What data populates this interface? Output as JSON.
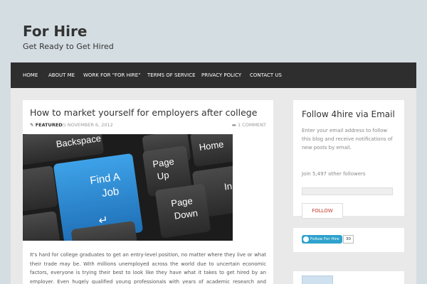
{
  "site": {
    "title": "For Hire",
    "description": "Get Ready to Get Hired"
  },
  "nav": {
    "items": [
      "HOME",
      "ABOUT ME",
      "WORK FOR \"FOR HIRE\"",
      "TERMS OF SERVICE",
      "PRIVACY POLICY",
      "CONTACT US"
    ]
  },
  "post": {
    "title": "How to market yourself for employers after college",
    "category": "FEATURED",
    "date": "NOVEMBER 6, 2012",
    "comments": "1 COMMENT",
    "image_keys": {
      "backspace": "Backspace",
      "home": "Home",
      "find": "Find A",
      "job": "Job",
      "page_up_1": "Page",
      "page_up_2": "Up",
      "page_down_1": "Page",
      "page_down_2": "Down",
      "partial": "In"
    },
    "excerpt": "It's hard for college graduates to get an entry-level position, no matter where they live or what their trade may be. With millions unemployed across the world due to uncertain economic factors, everyone is trying their best to look like they have what it takes to get hired by an employer. Even hugely qualified young professionals with years of academic research and training"
  },
  "sidebar": {
    "email_widget": {
      "title": "Follow 4hire via Email",
      "text": "Enter your email address to follow this blog and receive notifications of new posts by email.",
      "followers": "Join 5,497 other followers",
      "button": "FOLLOW"
    },
    "twitter_widget": {
      "button": "Follow For Hire",
      "count": "30"
    }
  }
}
